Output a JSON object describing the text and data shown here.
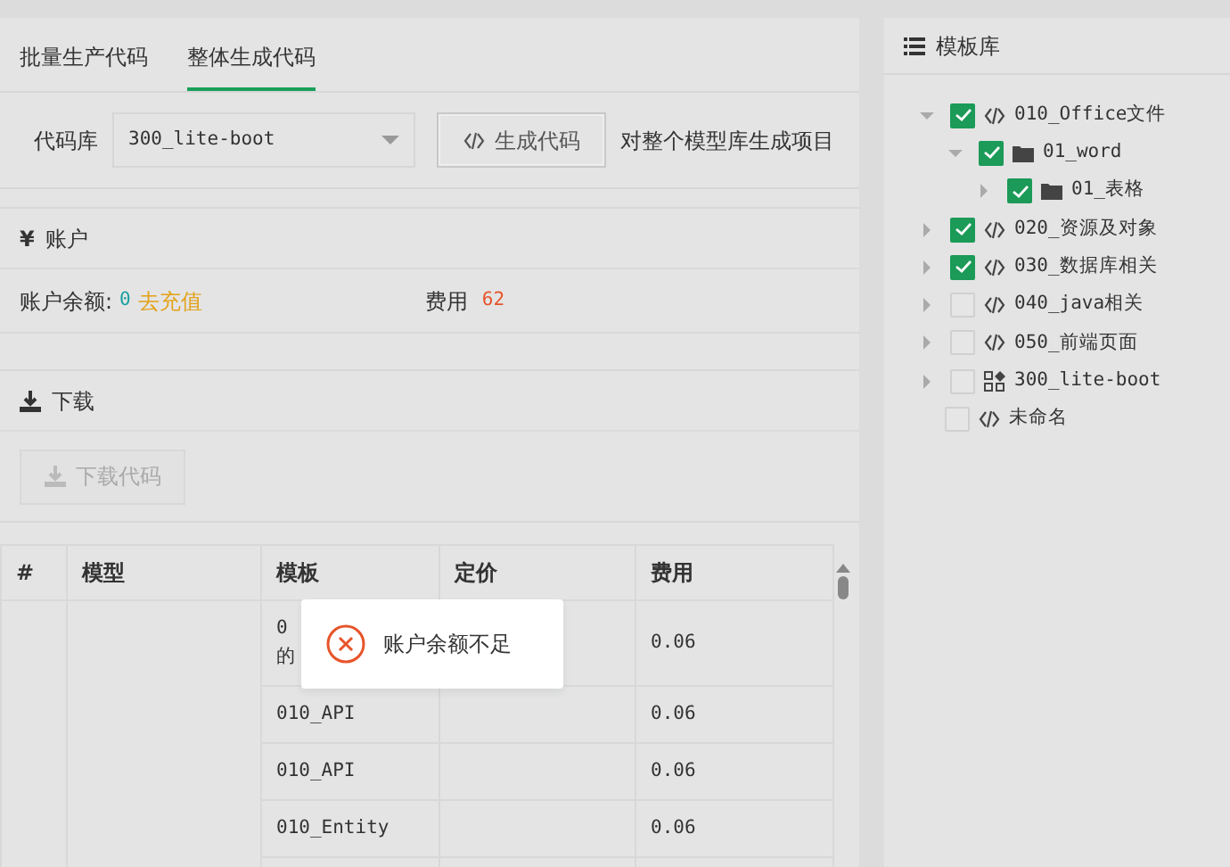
{
  "tabs": [
    {
      "label": "批量生产代码",
      "selected": false
    },
    {
      "label": "整体生成代码",
      "selected": true
    }
  ],
  "generator": {
    "label": "代码库",
    "select_value": "300_lite-boot",
    "button": "生成代码",
    "hint": "对整个模型库生成项目"
  },
  "account": {
    "title": "账户",
    "currency_icon": "¥",
    "balance_label": "账户余额:",
    "balance": "0",
    "recharge_link": "去充值",
    "fee_label": "费用",
    "fee": "62"
  },
  "download": {
    "title": "下载",
    "button": "下载代码",
    "disabled": true
  },
  "table": {
    "columns": [
      "#",
      "模型",
      "模板",
      "定价",
      "费用"
    ],
    "rows": [
      {
        "template": [
          "0",
          "的"
        ],
        "price": "",
        "fee": "0.06"
      },
      {
        "template": [
          "010_API"
        ],
        "price": "",
        "fee": "0.06"
      },
      {
        "template": [
          "010_API"
        ],
        "price": "",
        "fee": "0.06"
      },
      {
        "template": [
          "010_Entity"
        ],
        "price": "",
        "fee": "0.06"
      }
    ]
  },
  "toast": {
    "kind": "error",
    "message": "账户余额不足"
  },
  "library": {
    "title": "模板库",
    "tree": [
      {
        "label": "010_Office文件",
        "kind": "code",
        "checked": true,
        "expanded": true,
        "children": [
          {
            "label": "01_word",
            "kind": "folder",
            "checked": true,
            "expanded": true,
            "children": [
              {
                "label": "01_表格",
                "kind": "folder",
                "checked": true,
                "expanded": false
              }
            ]
          }
        ]
      },
      {
        "label": "020_资源及对象",
        "kind": "code",
        "checked": true,
        "expanded": false
      },
      {
        "label": "030_数据库相关",
        "kind": "code",
        "checked": true,
        "expanded": false
      },
      {
        "label": "040_java相关",
        "kind": "code",
        "checked": false,
        "expanded": false
      },
      {
        "label": "050_前端页面",
        "kind": "code",
        "checked": false,
        "expanded": false
      },
      {
        "label": "300_lite-boot",
        "kind": "app",
        "checked": false,
        "expanded": false
      },
      {
        "label": "未命名",
        "kind": "code",
        "checked": false
      }
    ]
  }
}
